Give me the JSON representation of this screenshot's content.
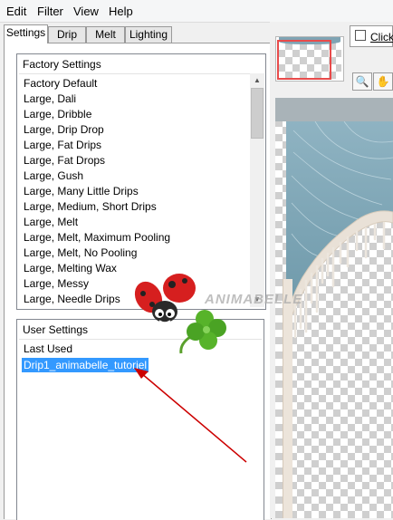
{
  "menu": {
    "items": [
      "Edit",
      "Filter",
      "View",
      "Help"
    ]
  },
  "tabs": [
    "Settings",
    "Drip",
    "Melt",
    "Lighting"
  ],
  "factory_settings": {
    "header": "Factory Settings",
    "items": [
      "Factory Default",
      "Large, Dali",
      "Large, Dribble",
      "Large, Drip Drop",
      "Large, Fat Drips",
      "Large, Fat Drops",
      "Large, Gush",
      "Large, Many Little Drips",
      "Large, Medium, Short Drips",
      "Large, Melt",
      "Large, Melt, Maximum Pooling",
      "Large, Melt, No Pooling",
      "Large, Melting Wax",
      "Large, Messy",
      "Large, Needle Drips"
    ]
  },
  "user_settings": {
    "header": "User Settings",
    "items": [
      "Last Used",
      "Drip1_animabelle_tutoriel"
    ],
    "selected": "Drip1_animabelle_tutoriel"
  },
  "preview": {
    "hint": "Click"
  },
  "watermark": "ANIMABELLE",
  "colors": {
    "selection": "#3399ff",
    "arrow": "#cc0000",
    "navigator_frame": "#e84b4b",
    "preview_blue": "#7fa4b4"
  },
  "icons": [
    "zoom-icon",
    "hand-icon",
    "scroll-up-icon",
    "scroll-down-icon",
    "ladybug-icon",
    "clover-icon",
    "red-arrow-icon"
  ]
}
